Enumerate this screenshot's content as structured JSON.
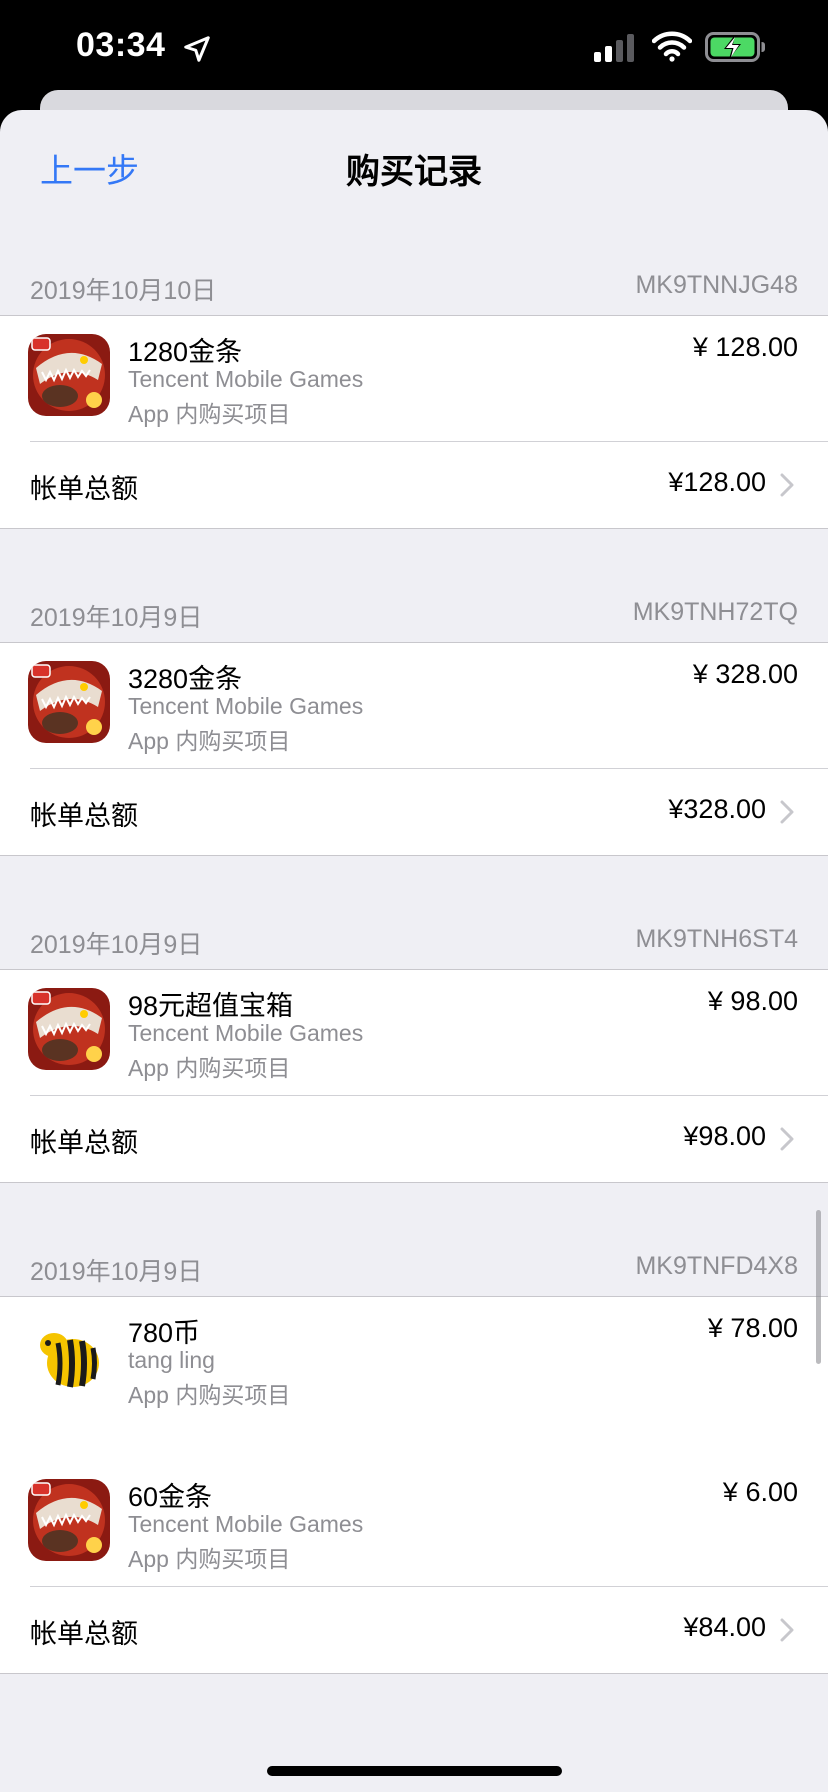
{
  "status_bar": {
    "time": "03:34",
    "icons": [
      "location-icon",
      "signal-icon",
      "wifi-icon",
      "battery-charging-icon"
    ]
  },
  "nav": {
    "back_label": "上一步",
    "title": "购买记录"
  },
  "colors": {
    "accent": "#3478f6",
    "background": "#efeff4",
    "secondary_text": "#8e8e93"
  },
  "groups": [
    {
      "date": "2019年10月10日",
      "order_id": "MK9TNNJG48",
      "items": [
        {
          "name": "1280金条",
          "developer": "Tencent Mobile Games",
          "kind": "App 内购买项目",
          "price": "¥ 128.00",
          "icon": "shark-game-icon"
        }
      ],
      "total_label": "帐单总额",
      "total": "¥128.00"
    },
    {
      "date": "2019年10月9日",
      "order_id": "MK9TNH72TQ",
      "items": [
        {
          "name": "3280金条",
          "developer": "Tencent Mobile Games",
          "kind": "App 内购买项目",
          "price": "¥ 328.00",
          "icon": "shark-game-icon"
        }
      ],
      "total_label": "帐单总额",
      "total": "¥328.00"
    },
    {
      "date": "2019年10月9日",
      "order_id": "MK9TNH6ST4",
      "items": [
        {
          "name": "98元超值宝箱",
          "developer": "Tencent Mobile Games",
          "kind": "App 内购买项目",
          "price": "¥ 98.00",
          "icon": "shark-game-icon"
        }
      ],
      "total_label": "帐单总额",
      "total": "¥98.00"
    },
    {
      "date": "2019年10月9日",
      "order_id": "MK9TNFD4X8",
      "items": [
        {
          "name": "780币",
          "developer": "tang ling",
          "kind": "App 内购买项目",
          "price": "¥ 78.00",
          "icon": "bee-app-icon"
        },
        {
          "name": "60金条",
          "developer": "Tencent Mobile Games",
          "kind": "App 内购买项目",
          "price": "¥ 6.00",
          "icon": "shark-game-icon"
        }
      ],
      "total_label": "帐单总额",
      "total": "¥84.00"
    }
  ]
}
